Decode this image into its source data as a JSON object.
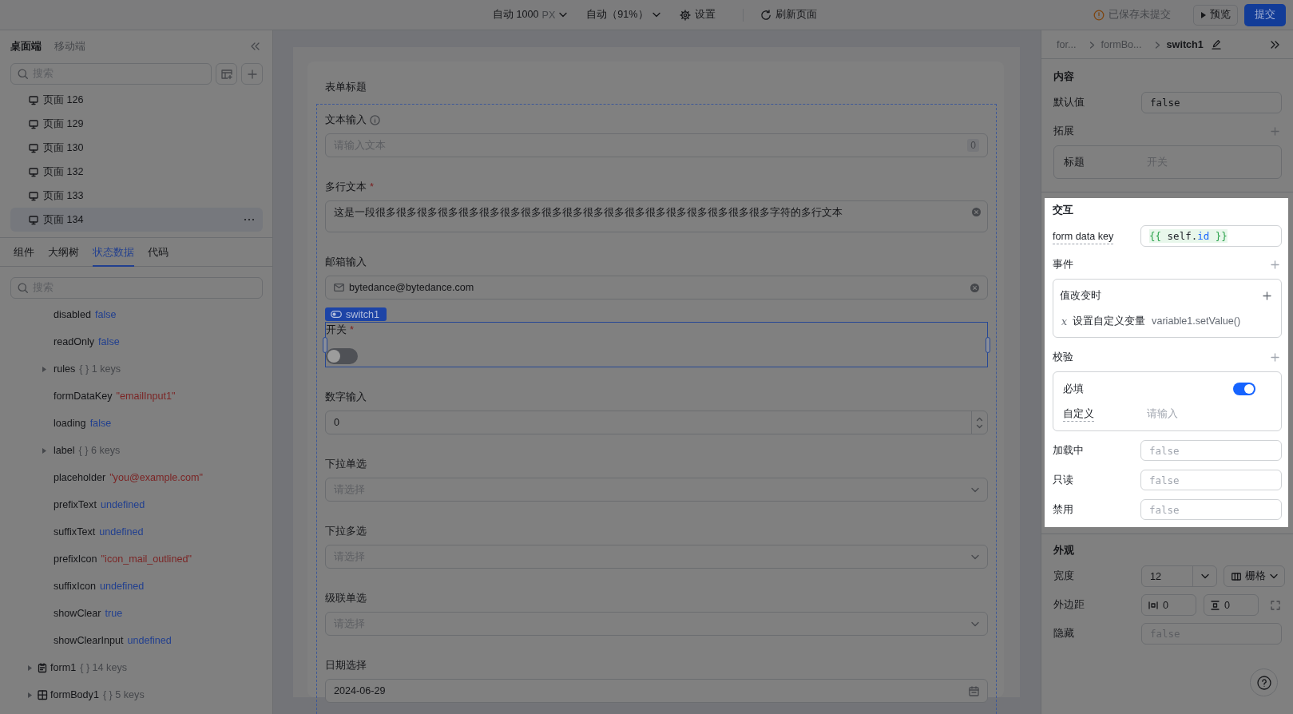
{
  "toolbar": {
    "width_select": {
      "value": "自动 1000",
      "unit": "PX"
    },
    "zoom_select": {
      "value": "自动（91%）"
    },
    "settings_button": "设置",
    "refresh_button": "刷新页面",
    "save_status": "已保存未提交",
    "preview_button": "预览",
    "submit_button": "提交"
  },
  "left_panel": {
    "platform_tabs": [
      {
        "label": "桌面端",
        "selected": true
      },
      {
        "label": "移动端",
        "selected": false
      }
    ],
    "page_search": {
      "placeholder": "搜索"
    },
    "pages": [
      {
        "label": "页面 126",
        "selected": false
      },
      {
        "label": "页面 129",
        "selected": false
      },
      {
        "label": "页面 130",
        "selected": false
      },
      {
        "label": "页面 132",
        "selected": false
      },
      {
        "label": "页面 133",
        "selected": false
      },
      {
        "label": "页面 134",
        "selected": true
      }
    ],
    "panel_tabs": [
      {
        "label": "组件",
        "selected": false
      },
      {
        "label": "大纲树",
        "selected": false
      },
      {
        "label": "状态数据",
        "selected": true
      },
      {
        "label": "代码",
        "selected": false
      }
    ],
    "state_search": {
      "placeholder": "搜索"
    },
    "state_tree": {
      "children_of_open_node": [
        {
          "key": "disabled",
          "value": "false",
          "kind": "keyword"
        },
        {
          "key": "readOnly",
          "value": "false",
          "kind": "keyword"
        },
        {
          "key": "rules",
          "summary": "{ } 1 keys",
          "kind": "object",
          "expanded": false
        },
        {
          "key": "formDataKey",
          "value": "\"emailInput1\"",
          "kind": "string"
        },
        {
          "key": "loading",
          "value": "false",
          "kind": "keyword"
        },
        {
          "key": "label",
          "summary": "{ } 6 keys",
          "kind": "object",
          "expanded": false
        },
        {
          "key": "placeholder",
          "value": "\"you@example.com\"",
          "kind": "string"
        },
        {
          "key": "prefixText",
          "value": "undefined",
          "kind": "keyword"
        },
        {
          "key": "suffixText",
          "value": "undefined",
          "kind": "keyword"
        },
        {
          "key": "prefixIcon",
          "value": "\"icon_mail_outlined\"",
          "kind": "string"
        },
        {
          "key": "suffixIcon",
          "value": "undefined",
          "kind": "keyword"
        },
        {
          "key": "showClear",
          "value": "true",
          "kind": "keyword"
        },
        {
          "key": "showClearInput",
          "value": "undefined",
          "kind": "keyword"
        }
      ],
      "next_nodes": [
        {
          "key": "form1",
          "summary": "{ } 14 keys",
          "kind": "form",
          "expanded": false
        },
        {
          "key": "formBody1",
          "summary": "{ } 5 keys",
          "kind": "layout",
          "expanded": false
        }
      ]
    }
  },
  "canvas": {
    "form_title": "表单标题",
    "fields": [
      {
        "kind": "text",
        "label": "文本输入",
        "info": true,
        "placeholder": "请输入文本",
        "counter": "0",
        "selected": false
      },
      {
        "kind": "textarea",
        "label": "多行文本",
        "required_mark": "*",
        "value": "这是一段很多很多很多很多很多很多很多很多很多很多很多很多很多很多很多很多很多很多很多字符的多行文本",
        "clearable": true,
        "selected": false
      },
      {
        "kind": "email",
        "label": "邮箱输入",
        "value": "bytedance@bytedance.com",
        "clearable": true,
        "selected": false
      },
      {
        "kind": "switch",
        "label": "开关",
        "required_mark": "*",
        "on": false,
        "selected": true,
        "badge": "switch1"
      },
      {
        "kind": "number",
        "label": "数字输入",
        "value": "0",
        "selected": false
      },
      {
        "kind": "select",
        "label": "下拉单选",
        "placeholder": "请选择",
        "selected": false
      },
      {
        "kind": "select",
        "label": "下拉多选",
        "placeholder": "请选择",
        "selected": false
      },
      {
        "kind": "select",
        "label": "级联单选",
        "placeholder": "请选择",
        "selected": false
      },
      {
        "kind": "date",
        "label": "日期选择",
        "value": "2024-06-29",
        "selected": false
      }
    ]
  },
  "inspector": {
    "breadcrumb": [
      {
        "label": "for...",
        "current": false
      },
      {
        "label": "formBo...",
        "current": false
      },
      {
        "label": "switch1",
        "current": true
      }
    ],
    "sections": [
      {
        "kind": "content",
        "highlighted": false,
        "title": "内容",
        "default_value": {
          "label": "默认值",
          "value": "false"
        },
        "extension": {
          "title": "拓展",
          "rows": [
            {
              "label": "标题",
              "placeholder": "开关"
            }
          ]
        }
      },
      {
        "kind": "interaction",
        "highlighted": true,
        "title": "交互",
        "form_data_key": {
          "label": "form data key",
          "code": [
            {
              "text": "{{ ",
              "kind": "brace"
            },
            {
              "text": "self.",
              "kind": "name"
            },
            {
              "text": "id",
              "kind": "property"
            },
            {
              "text": " }}",
              "kind": "brace"
            }
          ]
        },
        "events": {
          "title": "事件",
          "items": [
            {
              "trigger": "值改变时",
              "actions": [
                {
                  "icon": "x",
                  "label": "设置自定义变量",
                  "target": "variable1.setValue()"
                }
              ]
            }
          ]
        },
        "validation": {
          "title": "校验",
          "required": {
            "label": "必填",
            "on": true
          },
          "custom": {
            "label": "自定义",
            "placeholder": "请输入"
          }
        },
        "flags": [
          {
            "label": "加载中",
            "placeholder": "false"
          },
          {
            "label": "只读",
            "placeholder": "false"
          },
          {
            "label": "禁用",
            "placeholder": "false"
          }
        ]
      },
      {
        "kind": "appearance",
        "highlighted": false,
        "title": "外观",
        "width": {
          "label": "宽度",
          "value": "12",
          "layout": "栅格"
        },
        "margin": {
          "label": "外边距",
          "horizontal": "0",
          "vertical": "0"
        },
        "hidden": {
          "label": "隐藏",
          "placeholder": "false"
        }
      }
    ]
  }
}
